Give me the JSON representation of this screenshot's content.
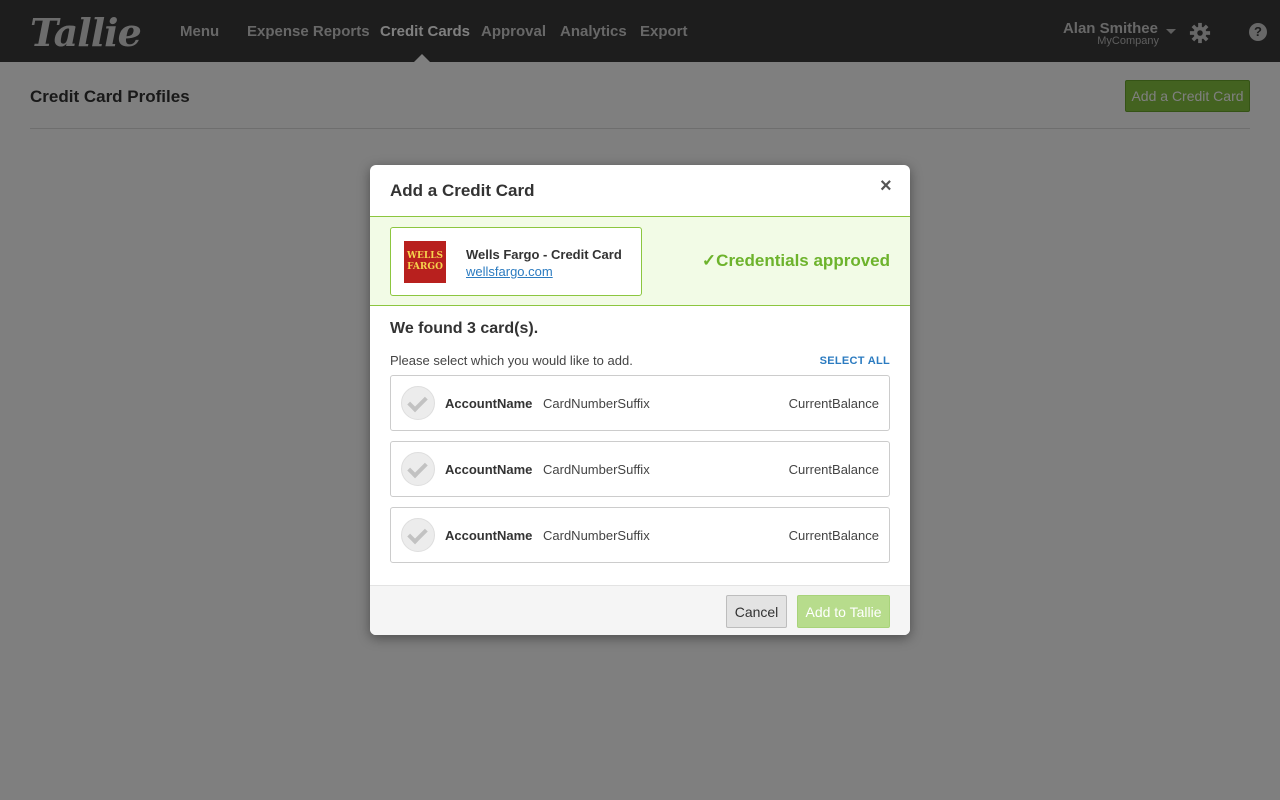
{
  "header": {
    "logo_text": "Tallie",
    "nav": [
      {
        "label": "Menu"
      },
      {
        "label": "Expense Reports"
      },
      {
        "label": "Credit Cards",
        "active": true
      },
      {
        "label": "Approval"
      },
      {
        "label": "Analytics"
      },
      {
        "label": "Export"
      }
    ],
    "user": {
      "name": "Alan Smithee",
      "company": "MyCompany"
    },
    "settings_icon": "gear-icon",
    "help_icon": "help-icon",
    "help_glyph": "?"
  },
  "page": {
    "title": "Credit Card Profiles",
    "add_button_label": "Add a Credit Card"
  },
  "modal": {
    "title": "Add a Credit Card",
    "close_glyph": "×",
    "bank": {
      "logo_line1": "WELLS",
      "logo_line2": "FARGO",
      "name": "Wells Fargo - Credit Card",
      "url": "wellsfargo.com"
    },
    "status": "✓Credentials approved",
    "found_text": "We found 3 card(s).",
    "instruction": "Please select which you would like to add.",
    "select_all_label": "SELECT ALL",
    "cards": [
      {
        "account_name": "AccountName",
        "suffix": "CardNumberSuffix",
        "balance": "CurrentBalance",
        "selected": false
      },
      {
        "account_name": "AccountName",
        "suffix": "CardNumberSuffix",
        "balance": "CurrentBalance",
        "selected": false
      },
      {
        "account_name": "AccountName",
        "suffix": "CardNumberSuffix",
        "balance": "CurrentBalance",
        "selected": false
      }
    ],
    "cancel_label": "Cancel",
    "submit_label": "Add to Tallie"
  },
  "colors": {
    "accent_green": "#86c540",
    "approved_green": "#6db32c",
    "link_blue": "#2b7bc0",
    "topbar": "#3a3a3a"
  }
}
